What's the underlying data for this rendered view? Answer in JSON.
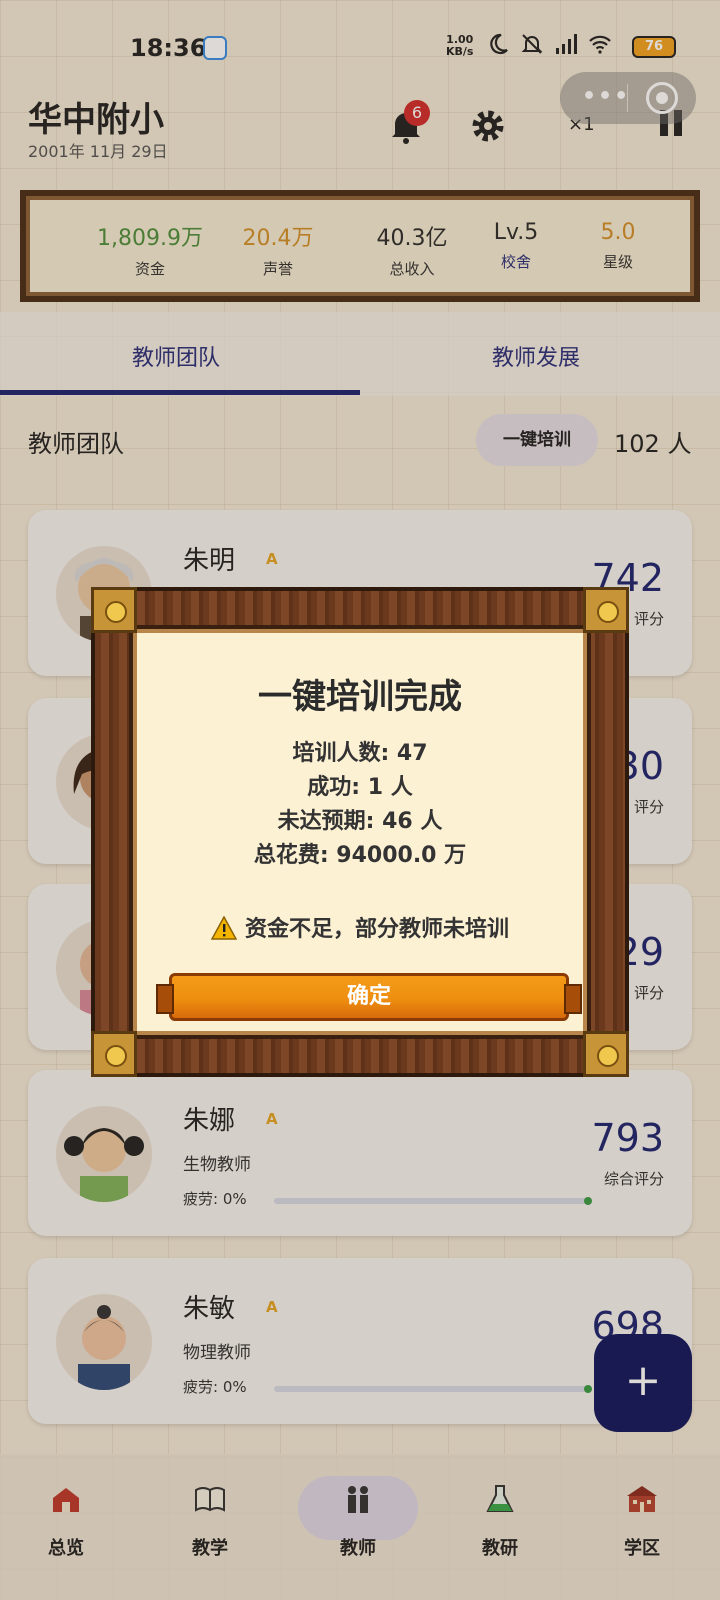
{
  "statusbar": {
    "time": "18:36",
    "net_speed_top": "1.00",
    "net_speed_bottom": "KB/s",
    "battery": "76"
  },
  "header": {
    "school_name": "华中附小",
    "date": "2001年 11月 29日",
    "notification_count": "6",
    "speed": "×1"
  },
  "stats": [
    {
      "value": "1,809.9万",
      "label": "资金",
      "color": "#4f8f3c"
    },
    {
      "value": "20.4万",
      "label": "声誉",
      "color": "#d4902a"
    },
    {
      "value": "40.3亿",
      "label": "总收入",
      "color": "#333333"
    },
    {
      "value": "Lv.5",
      "label": "校舍",
      "color": "#333333"
    },
    {
      "value": "5.0",
      "label": "星级",
      "color": "#d4902a"
    }
  ],
  "tabs": [
    "教师团队",
    "教师发展"
  ],
  "section": {
    "title": "教师团队",
    "train_button": "一键培训",
    "count": "102 人"
  },
  "teachers": [
    {
      "name": "朱明",
      "grade": "A",
      "subject": "",
      "fatigue": "",
      "score": "742",
      "score_label": "评分"
    },
    {
      "name": "",
      "grade": "",
      "subject": "",
      "fatigue": "",
      "score": "30",
      "score_label": "评分"
    },
    {
      "name": "",
      "grade": "",
      "subject": "",
      "fatigue": "",
      "score": "29",
      "score_label": "评分"
    },
    {
      "name": "朱娜",
      "grade": "A",
      "subject": "生物教师",
      "fatigue": "疲劳: 0%",
      "score": "793",
      "score_label": "综合评分"
    },
    {
      "name": "朱敏",
      "grade": "A",
      "subject": "物理教师",
      "fatigue": "疲劳: 0%",
      "score": "698",
      "score_label": ""
    }
  ],
  "bottom_nav": [
    {
      "label": "总览",
      "icon": "school-house-icon"
    },
    {
      "label": "教学",
      "icon": "book-icon"
    },
    {
      "label": "教师",
      "icon": "teachers-icon"
    },
    {
      "label": "教研",
      "icon": "flask-icon"
    },
    {
      "label": "学区",
      "icon": "campus-icon"
    }
  ],
  "modal": {
    "title": "一键培训完成",
    "lines": [
      "培训人数: 47",
      "成功: 1 人",
      "未达预期: 46 人",
      "总花费: 94000.0 万"
    ],
    "warning": "资金不足，部分教师未培训",
    "ok_button": "确定"
  },
  "fab_label": "+"
}
